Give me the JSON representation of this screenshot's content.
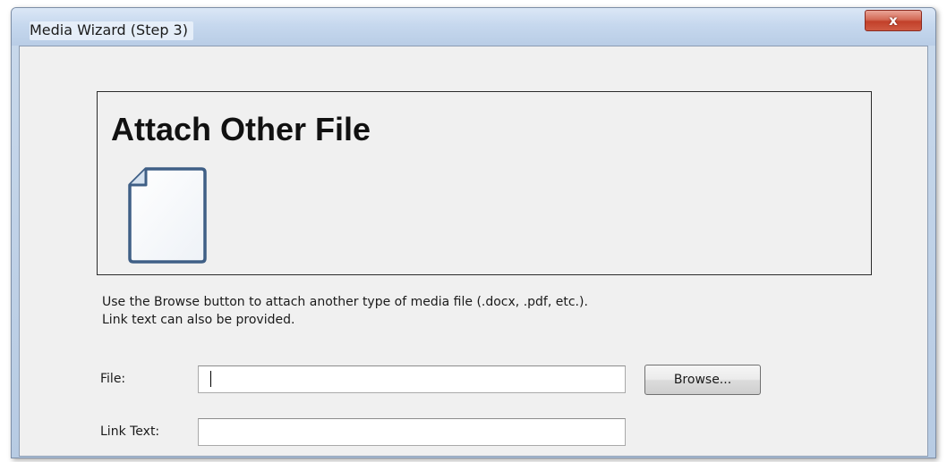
{
  "window": {
    "title": "Media Wizard (Step 3)",
    "close_glyph": "x",
    "close_icon": "close-icon"
  },
  "header": {
    "title": "Attach Other File",
    "icon": "document-icon"
  },
  "instructions": {
    "line1": "Use the Browse button to attach another type of media file (.docx, .pdf, etc.).",
    "line2": "Link text can also be provided."
  },
  "form": {
    "file_label": "File:",
    "file_value": "",
    "browse_label": "Browse...",
    "link_text_label": "Link Text:",
    "link_text_value": ""
  }
}
